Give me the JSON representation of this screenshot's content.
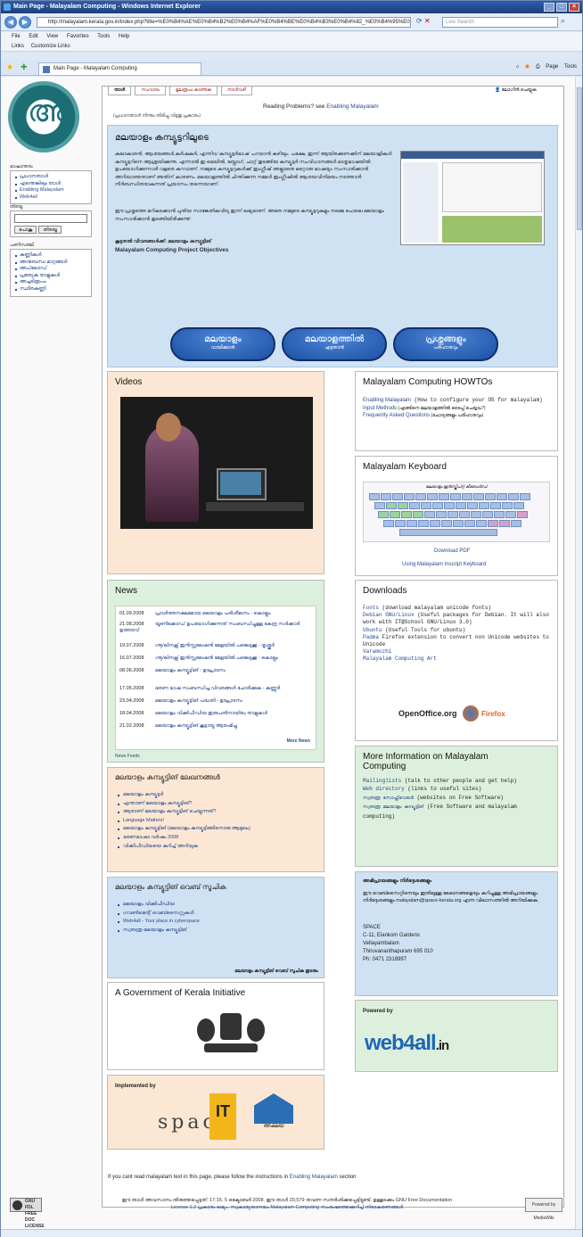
{
  "window": {
    "title": "Main Page - Malayalam Computing - Windows Internet Explorer",
    "url": "http://malayalam.kerala.gov.in/index.php?title=%E0%B4%AE%E0%B4%B2%E0%B4%AF%E0%B4%BE%E0%B4%B3%E0%B4%82_%E0%B4%95%E0%B4%AE%E0%B5%8D%E0%B4%AA%E0%B5%8D%E0%B4%AF%E0%B5%82%E0%B4%9F%E0%B4%BF%E0%B4%99%E0%B5%8D",
    "search_placeholder": "Live Search"
  },
  "menu": [
    "File",
    "Edit",
    "View",
    "Favorites",
    "Tools",
    "Help"
  ],
  "links_bar": {
    "label": "Links",
    "item": "Customize Links"
  },
  "tab": {
    "label": "Main Page - Malayalam Computing"
  },
  "toolbar": {
    "page": "Page",
    "tools": "Tools"
  },
  "page_tabs": [
    "താൾ",
    "സംവാദം",
    "മൂലരൂപം കാണുക",
    "നാൾവഴി"
  ],
  "user_tool": "ലോഗിൻ ചെയ്യുക",
  "reading": {
    "text": "Reading Problems? see ",
    "link": "Enabling Malayalam"
  },
  "subnote": "(പ്രധാനതാൾ നിന്നും തിരിച്ചു വിട്ടതു പ്രകാരം)",
  "sidebar": {
    "nav_head": "ഭാഷാന്തരം",
    "nav": [
      "പ്രധാനതാൾ",
      "എന്തെങ്കിലും താൾ",
      "Enabling Malayalam",
      "Web4all"
    ],
    "search_head": "തിരയൂ",
    "go": "പോകൂ",
    "search": "തിരയൂ",
    "tools_head": "പണിസഞ്ചി",
    "tools": [
      "കണ്ണികൾ",
      "അനുബന്ധ മാറ്റങ്ങൾ",
      "അപ്‌ലോഡ്",
      "പ്രത്യേക താളുകൾ",
      "അച്ചടിരൂപം",
      "സ്ഥിരകണ്ണി"
    ]
  },
  "intro": {
    "title": "മലയാളം കമ്പ്യൂട്ടറിലൂടെ",
    "p1": "കലാകാരൻ, ആശയങ്ങൾ,കർഷകർ, എന്നിവ 'കമ്പ്യൂട്ടർഭാഷ' പറയാൻ കഴിയും. പക്ഷേ, ഇന്ന് ആയിരക്കണക്കിന് മലയാളികൾ കമ്പ്യൂട്ടറിനെ ആശ്രയിക്കുന്നു. എന്നാൽ ഇ-മെയിൽ, ബ്ലോഗ്, ചാറ്റ് തുടങ്ങിയ കമ്പ്യൂട്ടർ സംവിധാനങ്ങൾ മാതൃഭാഷയിൽ ഉപയോഗിക്കുന്നവർ വളരെ കുറവാണ്. നമ്മുടെ കമ്പ്യൂട്ടറുകൾക്ക് ഇംഗ്ലീഷ് അല്ലാതെ മറ്റൊരു ഭാഷയും സംസാരിക്കാൻ അറിയാത്തതാണ് അതിന് കാരണം. മലയാളത്തിൽ ചിന്തിക്കുന്ന നമ്മൾ ഇംഗ്ലീഷിൽ ആശയവിനിമയം നടത്താൻ നിർബന്ധിതരാകുന്നത് പ്രയാസം തന്നെയാണ്.",
    "p2": "ഈ പ്രശ്നത്തെ മറികടക്കാൻ പുതിയ സാങ്കേതികവിദ്യ ഇന്ന് ലഭ്യമാണ്. അതേ നമ്മുടെ കമ്പ്യൂട്ടറുകളും നമ്മെ പോലെ മലയാളം സംസാരിക്കാൻ തുടങ്ങിയിരിക്കുന്നു!",
    "p3": "കൂടുതൽ വിവരങ്ങൾക്ക്: മലയാളം കമ്പ്യൂട്ടിങ്",
    "link": "Malayalam Computing Project Objectives",
    "buttons": [
      {
        "t1": "മലയാളം",
        "t2": "വായിക്കാൻ"
      },
      {
        "t1": "മലയാളത്തിൽ",
        "t2": "എഴുതാൻ"
      },
      {
        "t1": "പ്രശ്നങ്ങളും",
        "t2": "പരിഹാരവും"
      }
    ]
  },
  "videos": {
    "title": "Videos"
  },
  "howtos": {
    "title": "Malayalam Computing HOWTOs",
    "items": [
      {
        "link": "Enabling Malayalam",
        "desc": " (How to configure your OS for malayalam)"
      },
      {
        "link": "Input Methods",
        "desc": " (എങ്ങിനെ മലയാളത്തിൽ ടൈപ്പ് ചെയ്യാം?)"
      },
      {
        "link": "Frequently Asked Questions",
        "desc": " (ചോദ്യങ്ങളും പരിഹാരവും)"
      }
    ]
  },
  "keyboard": {
    "title": "Malayalam Keyboard",
    "caption": "മലയാളം ഇൻസ്ക്രിപ്റ്റ് കീബോർഡ്",
    "pdf": "Download PDF",
    "using": "Using Malayalam Inscript Keyboard"
  },
  "news": {
    "title": "News",
    "more": "More News",
    "feeds": "News Feeds",
    "items": [
      {
        "d": "01.09.2008",
        "t": "പ്രവർത്തനക്ഷമമായ മലയാളം പരിശീലനം - കൊല്ലം"
      },
      {
        "d": "21.08.2008",
        "t": "യൂണിക്കോഡ് ഉപയോഗിക്കുന്നത് സംബന്ധിച്ചുള്ള കേന്ദ്ര സർക്കാർ ഉത്തരവ്"
      },
      {
        "d": "19.07.2008",
        "t": "ഗ്നൂ/ലിനക്സ് ഇൻസ്റ്റലേഷൻ മേളയിൽ പങ്കെടുക്കൂ - തൃശ്ശൂർ"
      },
      {
        "d": "16.07.2008",
        "t": "ഗ്നൂ/ലിനക്സ് ഇൻസ്റ്റലേഷൻ മേളയിൽ പങ്കെടുക്കൂ - കൊല്ലം"
      },
      {
        "d": "08.06.2008",
        "t": "മലയാളം കമ്പ്യൂട്ടിങ് - ഉദ്ഘാടനം"
      },
      {
        "d": "17.05.2008",
        "t": "ഭരണ ഭാഷ സംബന്ധിച്ച വിവരങ്ങൾ ചോദിക്കുക - കണ്ണൂർ"
      },
      {
        "d": "23.04.2008",
        "t": "മലയാളം കമ്പ്യൂട്ടിങ് പദ്ധതി - ഉദ്ഘാടനം"
      },
      {
        "d": "18.04.2008",
        "t": "മലയാളം വിക്കിപീഡിയ ഇരുപതിനായിരം താളുകൾ"
      },
      {
        "d": "21.02.2008",
        "t": "മലയാളം കമ്പ്യൂട്ടിങ് കൂട്ടായ്മ ആരംഭിച്ചു"
      }
    ]
  },
  "downloads": {
    "title": "Downloads",
    "items": [
      {
        "link": "Fonts",
        "desc": " (download malayalam unicode fonts)"
      },
      {
        "link": "Debian GNU/Linux",
        "desc": " (Useful packages for Debian. It will also work with IT@School GNU/Linux 3.0)"
      },
      {
        "link": "Ubuntu",
        "desc": " (Useful Tools for ubuntu)"
      },
      {
        "link": "Padma",
        "desc": " Firefox extension to convert non Unicode websites to Unicode"
      },
      {
        "link": "Varamozhi",
        "desc": ""
      },
      {
        "link": "Malayalam Computing Art",
        "desc": ""
      }
    ],
    "oo": "OpenOffice.org",
    "ff": "Firefox"
  },
  "articles": {
    "title": "മലയാളം കമ്പ്യൂട്ടിങ് ലേഖനങ്ങൾ",
    "items": [
      "മലയാളം കമ്പ്യൂട്ടർ",
      "എന്താണ് മലയാളം കമ്പ്യൂട്ടിങ്?",
      "ആരാണ് മലയാളം കമ്പ്യൂട്ടിങ് ചെയ്യുന്നത്?",
      "Language Matters!",
      "മലയാളം കമ്പ്യൂട്ടിങ് (മലയാളം കമ്പ്യൂട്ടിങ്ങിനൊരു ആമുഖം)",
      "ഭരണഭാഷാ വർഷം 2008",
      "വിക്കിപീഡിയയെ കുറിച്ച് അറിയുക"
    ]
  },
  "moreinfo": {
    "title": "More Information on Malayalam Computing",
    "items": [
      {
        "link": "Mailinglists",
        "desc": " (talk to other people and get help)"
      },
      {
        "link": "Web directory",
        "desc": " (links to useful sites)"
      },
      {
        "link": "സ്വതന്ത്ര സോഫ്റ്റ്‌വെയർ",
        "desc": " (websites on Free Software)"
      },
      {
        "link": "സ്വതന്ത്ര മലയാളം കമ്പ്യൂട്ടിങ്",
        "desc": " (Free Software and malayalam computing)"
      }
    ]
  },
  "webdir": {
    "title": "മലയാളം കമ്പ്യൂട്ടിങ് വെബ് സൂചിക",
    "items": [
      "മലയാളം വിക്കിപീഡിയ",
      "ഗവൺമെന്റ് വെബ്സൈറ്റുകൾ",
      "Web4all - Your place in cyberspace",
      "സ്വതന്ത്ര മലയാളം കമ്പ്യൂട്ടിങ്"
    ],
    "more": "മലയാളം കമ്പ്യൂട്ടിങ് വെബ് സൂചിക തുടരും"
  },
  "contact": {
    "title": "അഭിപ്രായങ്ങളും നിർദ്ദേശങ്ങളും",
    "body": "ഈ വെബ്സൈറ്റിനെയും ഇതിലുള്ള ലേഖനങ്ങളെയും കുറിച്ചുള്ള അഭിപ്രായങ്ങളും നിർദ്ദേശങ്ങളും malayalam@space-kerala.org എന്ന വിലാസത്തിൽ അറിയിക്കുക.",
    "addr": [
      "SPACE",
      "C-11, Elankom Gardens",
      "Vellayambalam",
      "Thiruvananthapuram 695 010",
      "Ph: 0471 2318997"
    ]
  },
  "gov": {
    "title": "A Government of Kerala Initiative"
  },
  "powered": {
    "title": "Powered by",
    "logo_main": "web4all",
    "logo_tld": ".in"
  },
  "implemented": {
    "title": "Implemented by",
    "space": "space",
    "kit": "IT",
    "akshaya": "അക്ഷയ"
  },
  "bottom_note": {
    "text": "If you cant read malayalam text in this page, please follow the instructions in ",
    "link": "Enabling Malayalam",
    "tail": " section"
  },
  "footer": {
    "gnu": "GNU FDL FREE DOC LICENSE",
    "line1": "ഈ താൾ അവസാനം തിരുത്തപ്പെട്ടത്: 17:15, 5 ഒക്ടോബർ 2008.   ഈ താൾ 20,579 തവണ സന്ദർശിക്കപ്പെട്ടിട്ടുണ്ട്.   ഉള്ളടക്കം GNU Free Documentation",
    "line2": "License 1.2 പ്രകാരം ലഭ്യം.   സ്വകാര്യതാനയം   Malayalam Computing സംരംഭത്തെക്കുറിച്ച്   നിരാകരണങ്ങൾ",
    "mw": "Powered by MediaWiki"
  }
}
